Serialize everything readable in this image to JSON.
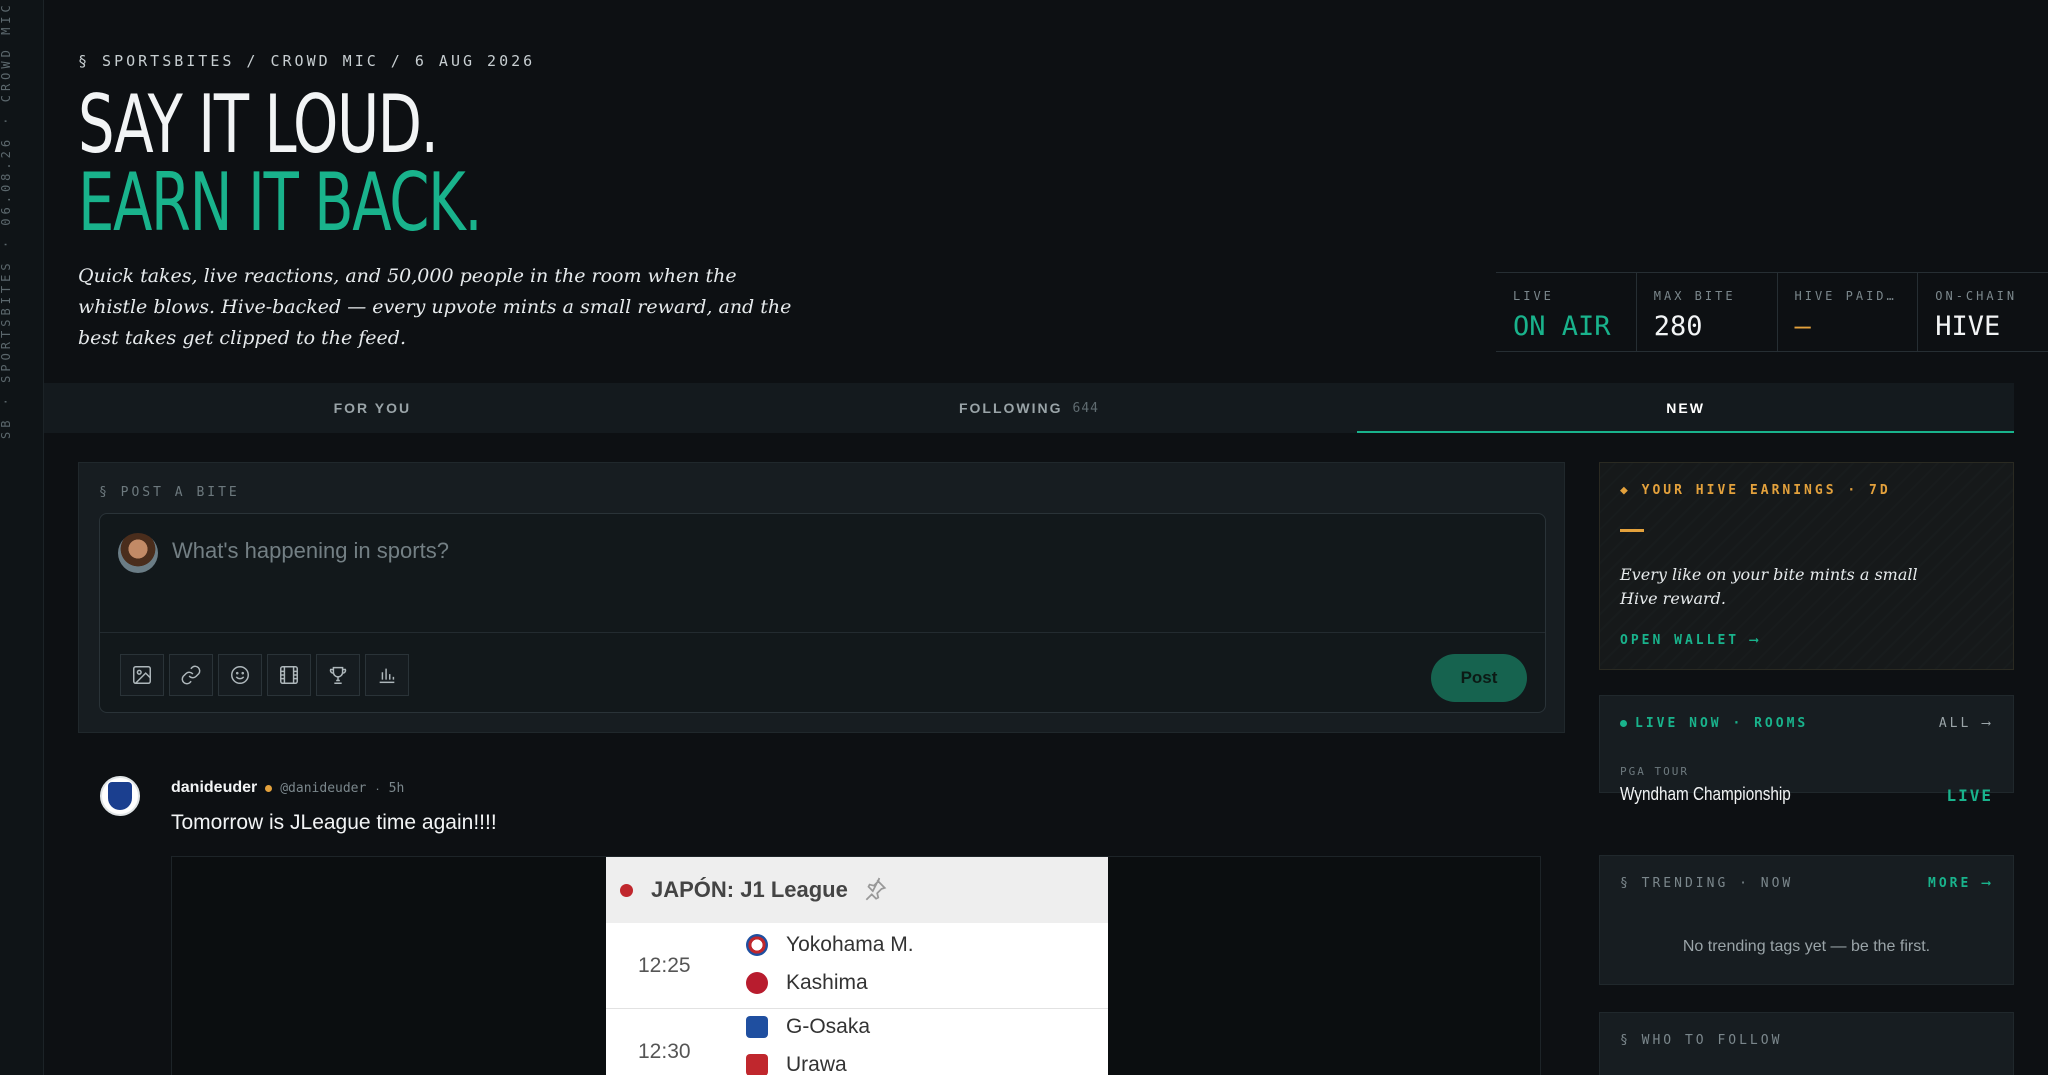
{
  "rail": {
    "text": "SB · SPORTSBITES · 06.08.26 · CROWD MIC"
  },
  "hero": {
    "breadcrumb": "§ SPORTSBITES / CROWD MIC / 6 AUG 2026",
    "title_line1": "SAY IT LOUD.",
    "title_line2": "EARN IT BACK.",
    "tagline": "Quick takes, live reactions, and 50,000 people in the room when the whistle blows. Hive-backed — every upvote mints a small reward, and the best takes get clipped to the feed."
  },
  "stats": [
    {
      "label": "LIVE",
      "value": "ON AIR"
    },
    {
      "label": "MAX BITE",
      "value": "280"
    },
    {
      "label": "HIVE PAID…",
      "value": "—"
    },
    {
      "label": "ON-CHAIN",
      "value": "HIVE"
    }
  ],
  "tabs": [
    {
      "label": "FOR YOU",
      "count": ""
    },
    {
      "label": "FOLLOWING",
      "count": "644"
    },
    {
      "label": "NEW",
      "count": ""
    }
  ],
  "composer": {
    "label": "§ POST A BITE",
    "placeholder": "What's happening in sports?",
    "post_label": "Post"
  },
  "post": {
    "author": "danideuder",
    "handle": "@danideuder",
    "separator": "·",
    "time": "5h",
    "text": "Tomorrow is JLeague time again!!!!",
    "embed": {
      "league": "JAPÓN: J1 League",
      "matches": [
        {
          "time": "12:25",
          "home": "Yokohama M.",
          "away": "Kashima"
        },
        {
          "time": "12:30",
          "home": "G-Osaka",
          "away": "Urawa"
        }
      ]
    }
  },
  "sidebar": {
    "earnings": {
      "label": "◆ YOUR HIVE EARNINGS · 7D",
      "text": "Every like on your bite mints a small Hive reward.",
      "link": "OPEN WALLET ⟶"
    },
    "live": {
      "label": "LIVE NOW · ROOMS",
      "all": "ALL ⟶",
      "tour": "PGA TOUR",
      "event": "Wyndham Championship",
      "tag": "LIVE"
    },
    "trending": {
      "label": "§ TRENDING · NOW",
      "more": "MORE ⟶",
      "empty": "No trending tags yet — be the first."
    },
    "follow": {
      "label": "§ WHO TO FOLLOW"
    }
  },
  "colors": {
    "accent": "#19b38c",
    "amber": "#e3a13c",
    "background": "#0d1013",
    "panel": "#171d21"
  }
}
